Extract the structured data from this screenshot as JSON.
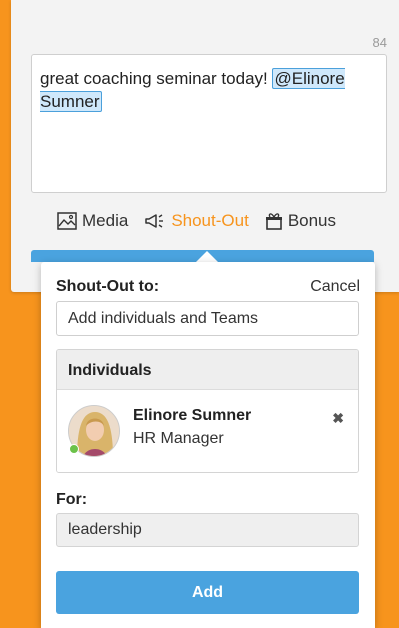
{
  "composer": {
    "char_count": "84",
    "text": "great coaching seminar today! ",
    "mention": "@Elinore Sumner"
  },
  "actions": [
    {
      "label": "Media",
      "icon": "image-icon"
    },
    {
      "label": "Shout-Out",
      "icon": "megaphone-icon",
      "active": true
    },
    {
      "label": "Bonus",
      "icon": "gift-icon"
    }
  ],
  "shoutout": {
    "title": "Shout-Out to:",
    "cancel_label": "Cancel",
    "recipient_placeholder": "Add individuals and Teams",
    "individuals_header": "Individuals",
    "individuals": [
      {
        "name": "Elinore Sumner",
        "role": "HR Manager",
        "status": "online"
      }
    ],
    "remove_icon": "close-icon",
    "for_label": "For:",
    "for_value": "leadership",
    "add_label": "Add"
  },
  "colors": {
    "background": "#f7941d",
    "accent": "#4aa3df",
    "active_action": "#f7941d",
    "online": "#6cc24a"
  }
}
